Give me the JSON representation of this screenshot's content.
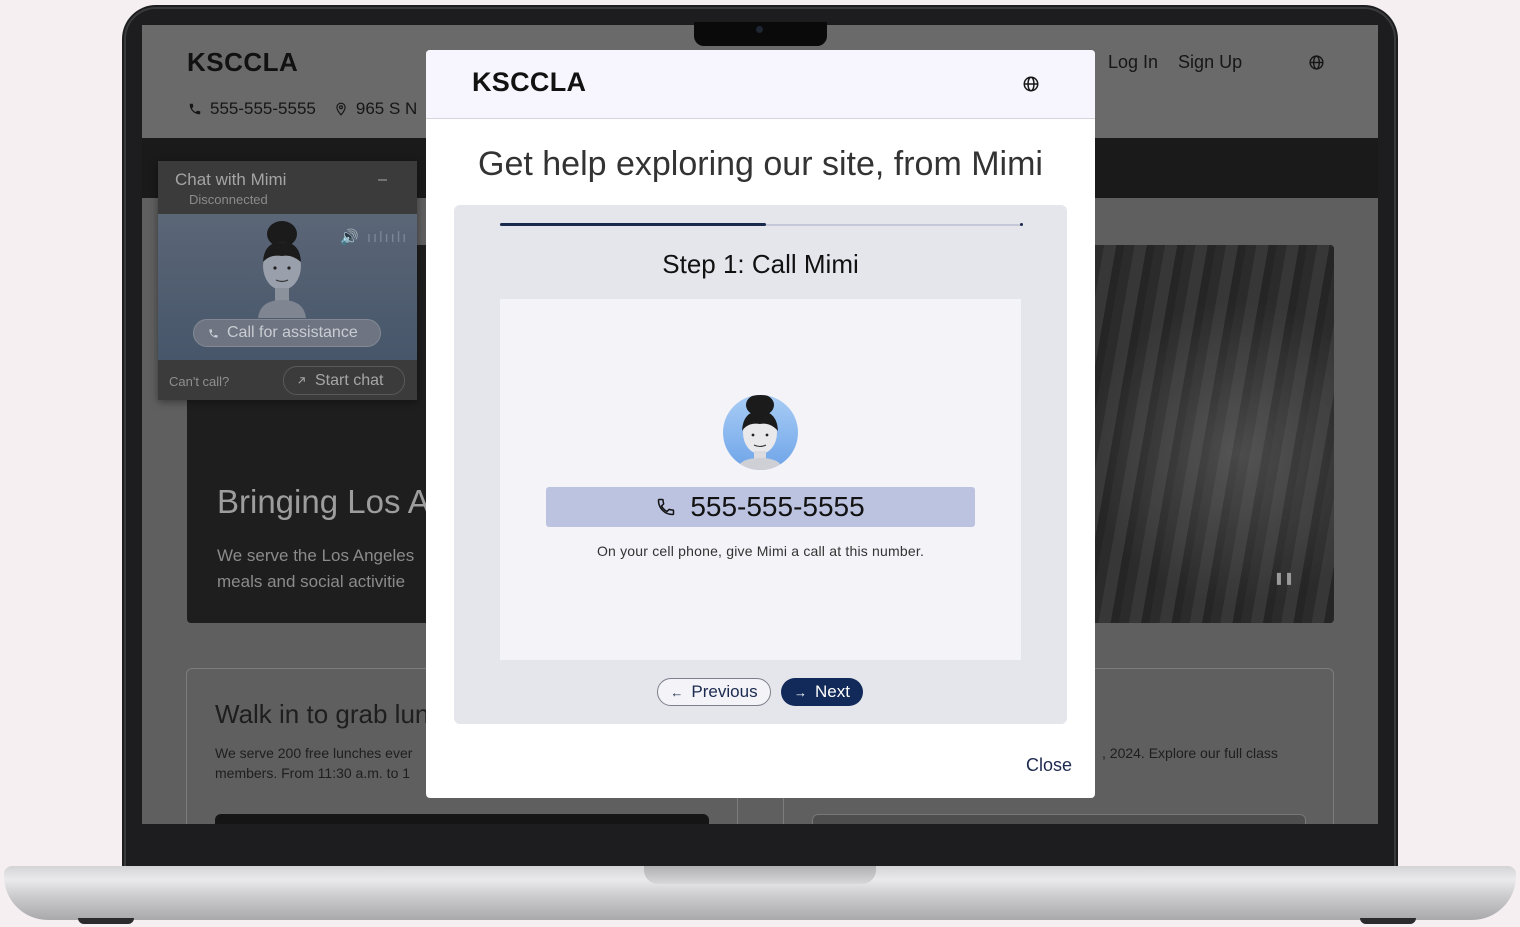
{
  "background_site": {
    "brand": "KSCCLA",
    "phone": "555-555-5555",
    "address": "965 S N",
    "nav": {
      "login": "Log In",
      "signup": "Sign Up"
    },
    "hero": {
      "title": "Bringing Los A",
      "subtitle_line1": "We serve the Los Angeles",
      "subtitle_line2": "meals and social activitie"
    },
    "card_left": {
      "title": "Walk in to grab lun",
      "body_line1": "We serve 200 free lunches ever",
      "body_line2": "members. From 11:30 a.m. to 1"
    },
    "card_right": {
      "body_line1": ", 2024. Explore our full class"
    }
  },
  "chat_widget": {
    "title": "Chat with Mimi",
    "status": "Disconnected",
    "minimize": "–",
    "call_button": "Call for assistance",
    "cant_call": "Can't call?",
    "start_chat": "Start chat"
  },
  "modal": {
    "logo": "KSCCLA",
    "heading": "Get help exploring our site, from Mimi",
    "progress": 0.51,
    "step_title": "Step 1: Call Mimi",
    "phone_number": "555-555-5555",
    "phone_help": "On your cell phone, give Mimi a call at this number.",
    "previous": "Previous",
    "next": "Next",
    "close": "Close"
  },
  "colors": {
    "primary_navy": "#112a5a",
    "phone_bar": "#bcc3e0",
    "panel": "#e5e5ec",
    "overlay_dim": "#5f5f60"
  }
}
